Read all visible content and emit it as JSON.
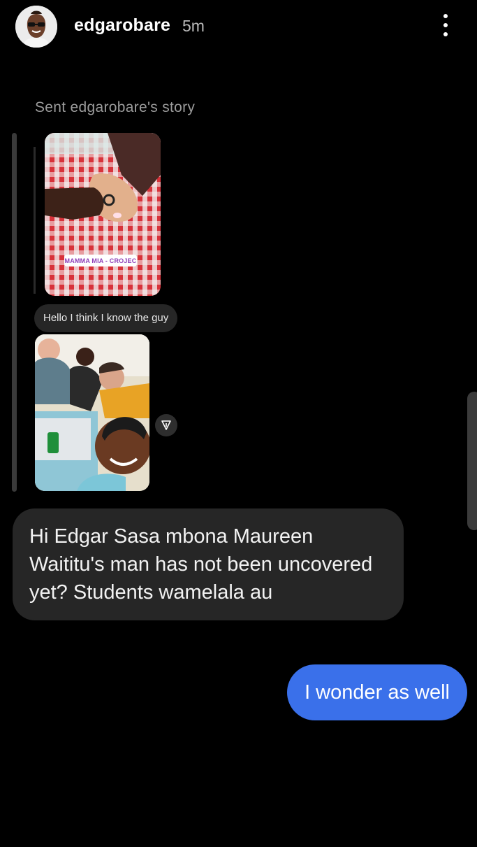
{
  "header": {
    "username": "edgarobare",
    "time": "5m",
    "more_icon": "more-vertical-icon"
  },
  "thread": {
    "sent_story_label": "Sent edgarobare's story",
    "story_location_sticker": "MAMMA MIA - CROJEC",
    "quoted_reply": "Hello I think I know the guy",
    "share_icon": "send-arrow-icon"
  },
  "messages": {
    "received_text": "Hi Edgar Sasa mbona Maureen Waititu's man has not been uncovered yet? Students wamelala au",
    "sent_text": "I wonder as well"
  },
  "colors": {
    "background": "#000000",
    "received_bubble": "#262626",
    "sent_bubble": "#3a70ea",
    "muted_text": "#9c9c9c"
  }
}
